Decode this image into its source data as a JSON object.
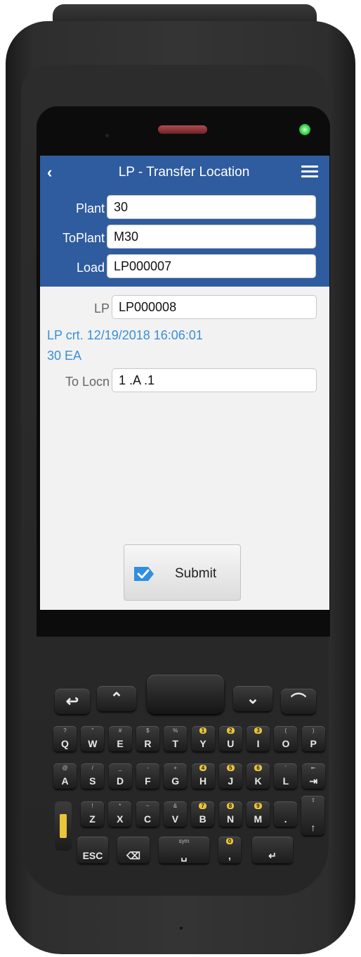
{
  "header": {
    "title": "LP - Transfer Location",
    "fields": [
      {
        "label": "Plant",
        "value": "30"
      },
      {
        "label": "ToPlant",
        "value": "M30"
      },
      {
        "label": "Load",
        "value": "LP000007"
      }
    ]
  },
  "body": {
    "lp_label": "LP",
    "lp_value": "LP000008",
    "info_line1": "LP crt. 12/19/2018 16:06:01",
    "info_line2": "30 EA",
    "to_locn_label": "To Locn",
    "to_locn_value": "1 .A .1"
  },
  "submit": {
    "label": "Submit",
    "icon": "checkmark-tag-icon"
  },
  "colors": {
    "header_bg": "#2e5c9e",
    "info_text": "#3a8fd6",
    "led": "#2ecc40"
  },
  "keypad": {
    "row1": [
      {
        "main": "Q",
        "sub": "?"
      },
      {
        "main": "W",
        "sub": "\""
      },
      {
        "main": "E",
        "sub": "#"
      },
      {
        "main": "R",
        "sub": "$"
      },
      {
        "main": "T",
        "sub": "%"
      },
      {
        "main": "Y",
        "sub": "1"
      },
      {
        "main": "U",
        "sub": "2"
      },
      {
        "main": "I",
        "sub": "3"
      },
      {
        "main": "O",
        "sub": "("
      },
      {
        "main": "P",
        "sub": ")"
      }
    ],
    "row2": [
      {
        "main": "A",
        "sub": "@"
      },
      {
        "main": "S",
        "sub": "/"
      },
      {
        "main": "D",
        "sub": "_"
      },
      {
        "main": "F",
        "sub": "-"
      },
      {
        "main": "G",
        "sub": "+"
      },
      {
        "main": "H",
        "sub": "4"
      },
      {
        "main": "J",
        "sub": "5"
      },
      {
        "main": "K",
        "sub": "6"
      },
      {
        "main": "L",
        "sub": "'"
      },
      {
        "main": "⇥",
        "sub": "⇤"
      }
    ],
    "row3": [
      {
        "main": "Z",
        "sub": "!"
      },
      {
        "main": "X",
        "sub": "*"
      },
      {
        "main": "C",
        "sub": "~"
      },
      {
        "main": "V",
        "sub": "&"
      },
      {
        "main": "B",
        "sub": "7"
      },
      {
        "main": "N",
        "sub": "8"
      },
      {
        "main": "M",
        "sub": "9"
      },
      {
        "main": ".",
        "sub": ""
      },
      {
        "main": "↑",
        "sub": "⇧"
      }
    ],
    "row4": [
      {
        "main": "ESC",
        "sub": ""
      },
      {
        "main": "⌫",
        "sub": ""
      },
      {
        "main": "␣",
        "sub": "sym"
      },
      {
        "main": ",",
        "sub": "0"
      },
      {
        "main": "↵",
        "sub": ""
      }
    ],
    "nav": [
      "call-icon",
      "page-up-icon",
      "page-down-icon",
      "end-call-icon"
    ]
  }
}
